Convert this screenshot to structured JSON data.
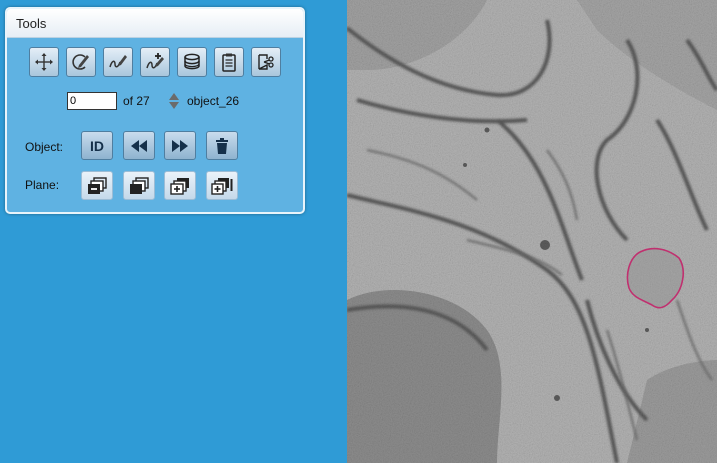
{
  "panel": {
    "title": "Tools"
  },
  "toolbar": {
    "tools": [
      {
        "icon": "move-icon"
      },
      {
        "icon": "edit-region-icon"
      },
      {
        "icon": "draw-pen-icon"
      },
      {
        "icon": "add-object-icon"
      },
      {
        "icon": "layers-icon"
      },
      {
        "icon": "clipboard-icon"
      },
      {
        "icon": "cut-split-icon"
      }
    ]
  },
  "counter": {
    "input_value": "0",
    "of_text": "of 27",
    "object_name": "object_26"
  },
  "object_row": {
    "label": "Object:",
    "id_label": "ID",
    "icons": [
      "rewind-icon",
      "fast-forward-icon",
      "trash-icon"
    ]
  },
  "plane_row": {
    "label": "Plane:",
    "icons": [
      "plane-remove-icon",
      "plane-copy-icon",
      "plane-add-icon",
      "plane-add-all-icon"
    ]
  },
  "colors": {
    "background": "#2f9bd6",
    "panel": "#5fb2e2",
    "annotation_outline": "#c0306f"
  }
}
